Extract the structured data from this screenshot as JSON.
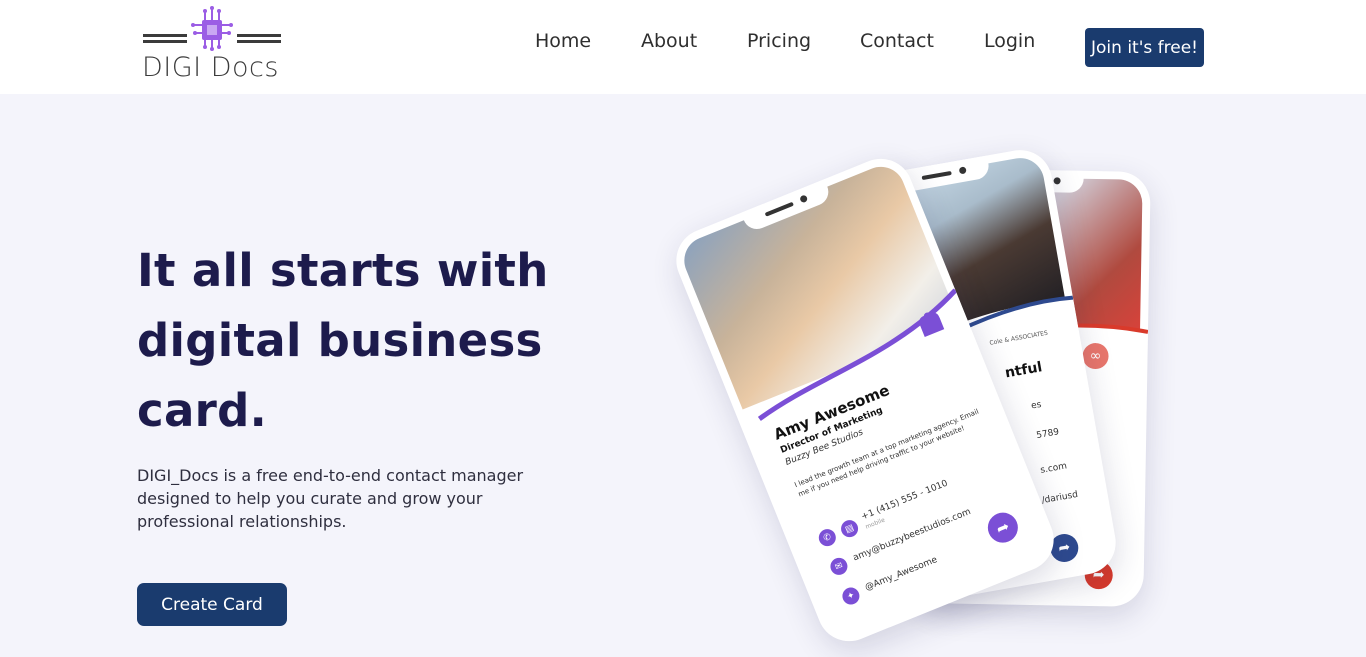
{
  "brand": {
    "name": "DIGI Docs",
    "accent": "#9b5de5"
  },
  "nav": {
    "home": "Home",
    "about": "About",
    "pricing": "Pricing",
    "contact": "Contact",
    "login": "Login",
    "join": "Join it's free!"
  },
  "hero": {
    "title": "It all starts with digital business card.",
    "description": "DIGI_Docs is a free end-to-end contact manager designed to help you curate and grow your professional relationships.",
    "cta": "Create Card"
  },
  "cards": {
    "amy": {
      "name": "Amy Awesome",
      "role": "Director of Marketing",
      "company": "Buzzy Bee Studios",
      "bio": "I lead the growth team at a top marketing agency. Email me if you need help driving traffic to your website!",
      "phone": "+1 (415) 555 - 1010",
      "phone_type": "mobile",
      "email": "amy@buzzybeestudios.com",
      "twitter": "@Amy_Awesome",
      "color": "#7b4fd6"
    },
    "darius": {
      "name_fragment": "ntful",
      "line1": "es",
      "line2": "5789",
      "line3": "s.com",
      "line4": "/dariusd",
      "badge": "Cole & ASSOCIATES",
      "color": "#2e4a8f"
    },
    "third": {
      "color": "#d93a2b"
    }
  },
  "colors": {
    "primary_button": "#1a3b6e",
    "hero_text": "#1d1b4c",
    "background": "#f4f4fb"
  }
}
